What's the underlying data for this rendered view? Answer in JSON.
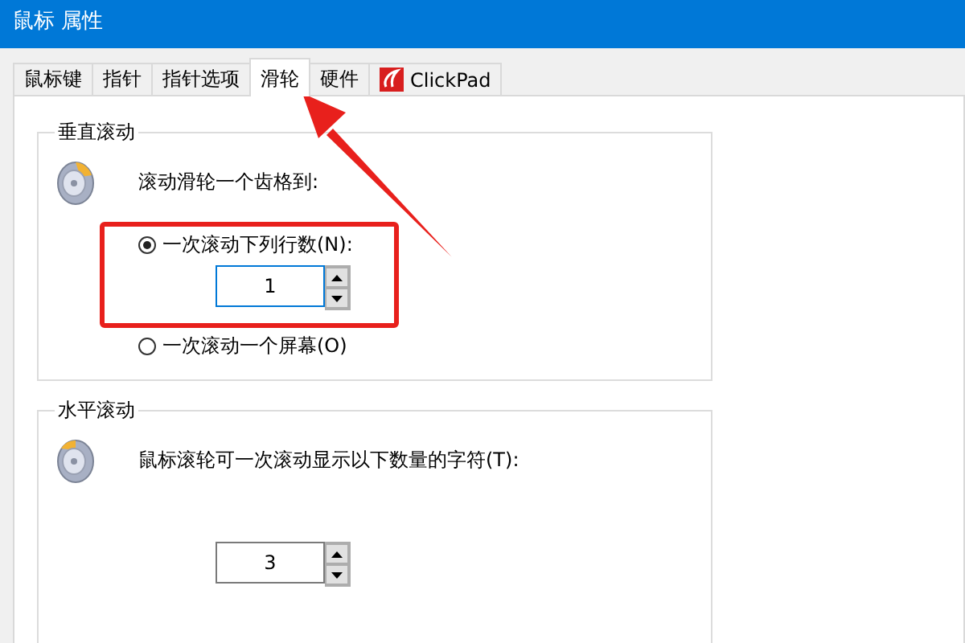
{
  "window": {
    "title": "鼠标 属性"
  },
  "tabs": [
    {
      "label": "鼠标键",
      "selected": false,
      "kind": "text"
    },
    {
      "label": "指针",
      "selected": false,
      "kind": "text"
    },
    {
      "label": "指针选项",
      "selected": false,
      "kind": "text"
    },
    {
      "label": "滑轮",
      "selected": true,
      "kind": "text"
    },
    {
      "label": "硬件",
      "selected": false,
      "kind": "text"
    },
    {
      "label": "ClickPad",
      "selected": false,
      "kind": "logo"
    }
  ],
  "vertical_scrolling": {
    "title": "垂直滚动",
    "prompt": "滚动滑轮一个齿格到:",
    "options": [
      {
        "label": "一次滚动下列行数(N):",
        "selected": true,
        "value": "1"
      },
      {
        "label": "一次滚动一个屏幕(O)",
        "selected": false
      }
    ]
  },
  "horizontal_scrolling": {
    "title": "水平滚动",
    "prompt": "鼠标滚轮可一次滚动显示以下数量的字符(T):",
    "value": "3"
  }
}
